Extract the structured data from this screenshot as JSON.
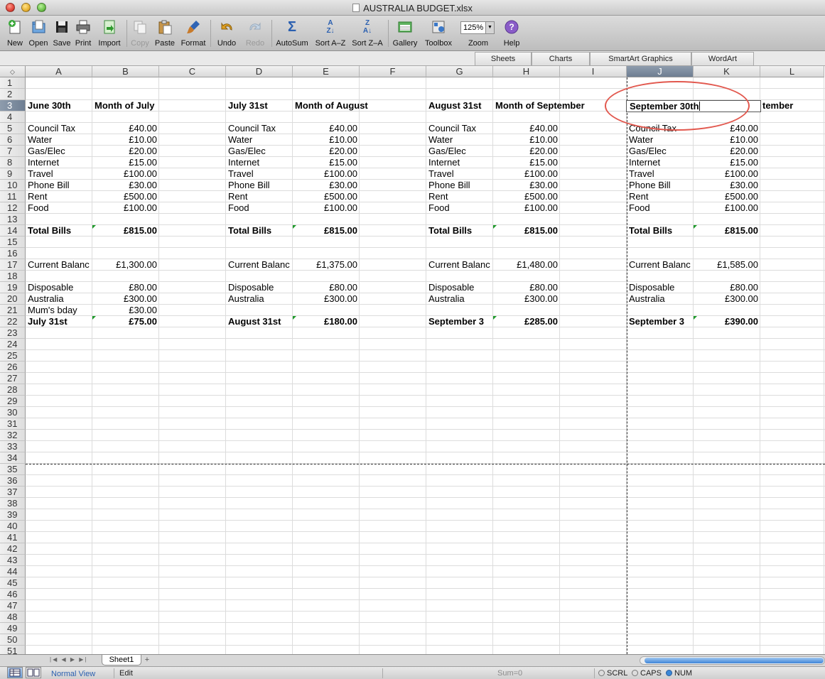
{
  "window": {
    "title": "AUSTRALIA BUDGET.xlsx"
  },
  "toolbar": {
    "new": "New",
    "open": "Open",
    "save": "Save",
    "print": "Print",
    "import": "Import",
    "copy": "Copy",
    "paste": "Paste",
    "format": "Format",
    "undo": "Undo",
    "redo": "Redo",
    "autosum": "AutoSum",
    "sort_az": "Sort A–Z",
    "sort_za": "Sort Z–A",
    "gallery": "Gallery",
    "toolbox": "Toolbox",
    "zoom_label": "Zoom",
    "zoom_value": "125%",
    "help": "Help"
  },
  "ribbon_tabs": [
    "Sheets",
    "Charts",
    "SmartArt Graphics",
    "WordArt"
  ],
  "columns": [
    "A",
    "B",
    "C",
    "D",
    "E",
    "F",
    "G",
    "H",
    "I",
    "J",
    "K",
    "L"
  ],
  "selected_column": "J",
  "selected_row": "3",
  "rows": [
    "1",
    "2",
    "3",
    "4",
    "5",
    "6",
    "7",
    "8",
    "9",
    "10",
    "11",
    "12",
    "13",
    "14",
    "15",
    "16",
    "17",
    "18",
    "19",
    "20",
    "21",
    "22",
    "23",
    "24",
    "25",
    "26",
    "27",
    "28",
    "29",
    "30",
    "31",
    "32",
    "33",
    "34",
    "35",
    "36",
    "37",
    "38",
    "39",
    "40",
    "41",
    "42",
    "43",
    "44",
    "45",
    "46",
    "47",
    "48",
    "49",
    "50",
    "51"
  ],
  "blocks": [
    {
      "header_date": "June 30th",
      "header_month": "Month of July",
      "items": [
        {
          "label": "Council Tax",
          "amount": "£40.00"
        },
        {
          "label": "Water",
          "amount": "£10.00"
        },
        {
          "label": "Gas/Elec",
          "amount": "£20.00"
        },
        {
          "label": "Internet",
          "amount": "£15.00"
        },
        {
          "label": "Travel",
          "amount": "£100.00"
        },
        {
          "label": "Phone Bill",
          "amount": "£30.00"
        },
        {
          "label": "Rent",
          "amount": "£500.00"
        },
        {
          "label": "Food",
          "amount": "£100.00"
        }
      ],
      "total_label": "Total Bills",
      "total": "£815.00",
      "balance_label": "Current Balanc",
      "balance": "£1,300.00",
      "disposable_label": "Disposable",
      "disposable": "£80.00",
      "australia_label": "Australia",
      "australia": "£300.00",
      "extra_label": "Mum's bday",
      "extra": "£30.00",
      "end_label": "July 31st",
      "end_value": "£75.00"
    },
    {
      "header_date": "July 31st",
      "header_month": "Month of August",
      "items": [
        {
          "label": "Council Tax",
          "amount": "£40.00"
        },
        {
          "label": "Water",
          "amount": "£10.00"
        },
        {
          "label": "Gas/Elec",
          "amount": "£20.00"
        },
        {
          "label": "Internet",
          "amount": "£15.00"
        },
        {
          "label": "Travel",
          "amount": "£100.00"
        },
        {
          "label": "Phone Bill",
          "amount": "£30.00"
        },
        {
          "label": "Rent",
          "amount": "£500.00"
        },
        {
          "label": "Food",
          "amount": "£100.00"
        }
      ],
      "total_label": "Total Bills",
      "total": "£815.00",
      "balance_label": "Current Balanc",
      "balance": "£1,375.00",
      "disposable_label": "Disposable",
      "disposable": "£80.00",
      "australia_label": "Australia",
      "australia": "£300.00",
      "end_label": "August 31st",
      "end_value": "£180.00"
    },
    {
      "header_date": "August 31st",
      "header_month": "Month of September",
      "items": [
        {
          "label": "Council Tax",
          "amount": "£40.00"
        },
        {
          "label": "Water",
          "amount": "£10.00"
        },
        {
          "label": "Gas/Elec",
          "amount": "£20.00"
        },
        {
          "label": "Internet",
          "amount": "£15.00"
        },
        {
          "label": "Travel",
          "amount": "£100.00"
        },
        {
          "label": "Phone Bill",
          "amount": "£30.00"
        },
        {
          "label": "Rent",
          "amount": "£500.00"
        },
        {
          "label": "Food",
          "amount": "£100.00"
        }
      ],
      "total_label": "Total Bills",
      "total": "£815.00",
      "balance_label": "Current Balanc",
      "balance": "£1,480.00",
      "disposable_label": "Disposable",
      "disposable": "£80.00",
      "australia_label": "Australia",
      "australia": "£300.00",
      "end_label": "September 3",
      "end_value": "£285.00"
    },
    {
      "header_date": "September 30th",
      "header_month": "tember",
      "items": [
        {
          "label": "Council Tax",
          "amount": "£40.00"
        },
        {
          "label": "Water",
          "amount": "£10.00"
        },
        {
          "label": "Gas/Elec",
          "amount": "£20.00"
        },
        {
          "label": "Internet",
          "amount": "£15.00"
        },
        {
          "label": "Travel",
          "amount": "£100.00"
        },
        {
          "label": "Phone Bill",
          "amount": "£30.00"
        },
        {
          "label": "Rent",
          "amount": "£500.00"
        },
        {
          "label": "Food",
          "amount": "£100.00"
        }
      ],
      "total_label": "Total Bills",
      "total": "£815.00",
      "balance_label": "Current Balanc",
      "balance": "£1,585.00",
      "disposable_label": "Disposable",
      "disposable": "£80.00",
      "australia_label": "Australia",
      "australia": "£300.00",
      "end_label": "September 3",
      "end_value": "£390.00"
    }
  ],
  "sheet_tabs": [
    "Sheet1"
  ],
  "status": {
    "view": "Normal View",
    "mode": "Edit",
    "sum": "Sum=0",
    "scrl": "SCRL",
    "caps": "CAPS",
    "num": "NUM"
  },
  "colors": {
    "annotation_circle": "#e2584e",
    "selected_header": "#6e7e92",
    "comment_marker": "#1e9a2a"
  }
}
